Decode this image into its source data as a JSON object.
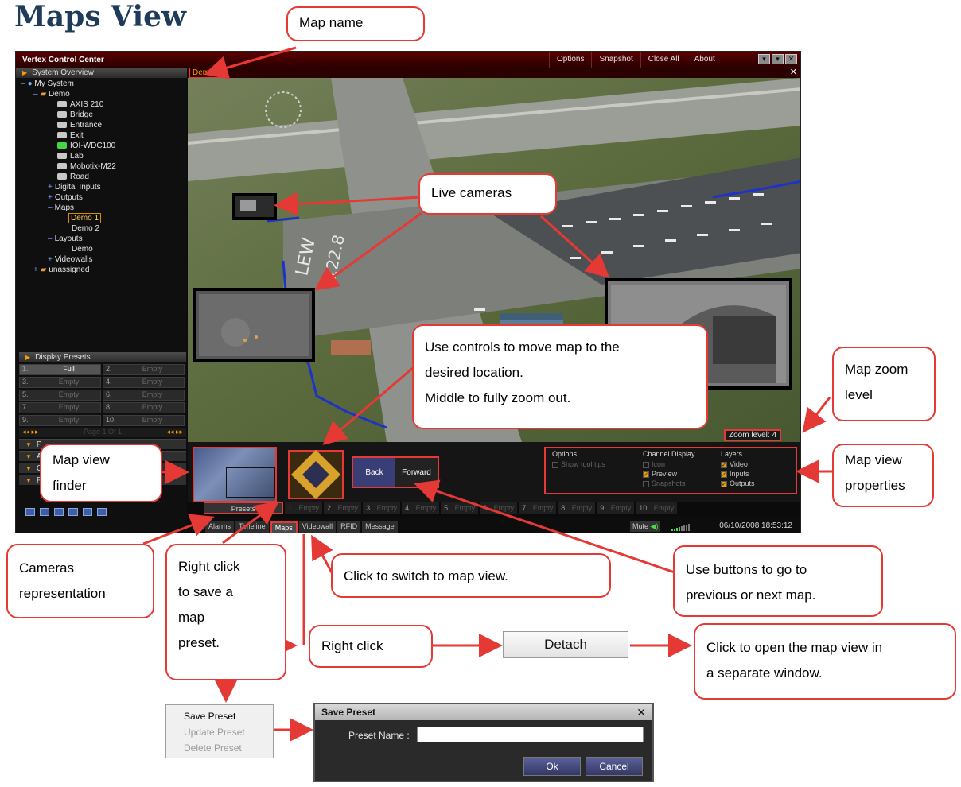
{
  "page": {
    "heading": "Maps View"
  },
  "app": {
    "title": "Vertex Control Center",
    "menu": [
      "Options",
      "Snapshot",
      "Close All",
      "About"
    ],
    "sidebar": {
      "overview_header": "System Overview",
      "tree": [
        {
          "label": "My System",
          "icon": "globe-icon"
        },
        {
          "label": "Demo",
          "icon": "folder-icon"
        },
        {
          "label": "AXIS 210",
          "icon": "camera-icon"
        },
        {
          "label": "Bridge",
          "icon": "camera-icon"
        },
        {
          "label": "Entrance",
          "icon": "camera-icon"
        },
        {
          "label": "Exit",
          "icon": "camera-icon"
        },
        {
          "label": "IOI-WDC100",
          "icon": "camera-icon"
        },
        {
          "label": "Lab",
          "icon": "camera-icon"
        },
        {
          "label": "Mobotix-M22",
          "icon": "camera-icon"
        },
        {
          "label": "Road",
          "icon": "camera-icon"
        },
        {
          "label": "Digital Inputs",
          "icon": "plus-icon"
        },
        {
          "label": "Outputs",
          "icon": "plus-icon"
        },
        {
          "label": "Maps",
          "icon": "minus-icon"
        },
        {
          "label": "Demo 1",
          "icon": "map-icon"
        },
        {
          "label": "Demo 2",
          "icon": "map-icon"
        },
        {
          "label": "Layouts",
          "icon": "minus-icon"
        },
        {
          "label": "Demo",
          "icon": "layout-icon"
        },
        {
          "label": "Videowalls",
          "icon": "plus-icon"
        },
        {
          "label": "unassigned",
          "icon": "folder-icon"
        }
      ],
      "display_presets_header": "Display Presets",
      "display_presets": [
        {
          "num": "1.",
          "label": "Full"
        },
        {
          "num": "2.",
          "label": "Empty"
        },
        {
          "num": "3.",
          "label": "Empty"
        },
        {
          "num": "4.",
          "label": "Empty"
        },
        {
          "num": "5.",
          "label": "Empty"
        },
        {
          "num": "6.",
          "label": "Empty"
        },
        {
          "num": "7.",
          "label": "Empty"
        },
        {
          "num": "8.",
          "label": "Empty"
        },
        {
          "num": "9.",
          "label": "Empty"
        },
        {
          "num": "10.",
          "label": "Empty"
        }
      ],
      "preset_page": "Page 1 Of 1",
      "collapsed_sections": [
        "P",
        "A",
        "C",
        "P"
      ]
    },
    "map_name": "Demo 1",
    "zoom_level": "Zoom level: 4",
    "nav": {
      "back": "Back",
      "forward": "Forward"
    },
    "properties": {
      "options_title": "Options",
      "options": [
        {
          "label": "Show tool tips",
          "checked": false
        }
      ],
      "channel_title": "Channel Display",
      "channel": [
        {
          "label": "Icon",
          "checked": false
        },
        {
          "label": "Preview",
          "checked": true
        },
        {
          "label": "Snapshots",
          "checked": false
        }
      ],
      "layers_title": "Layers",
      "layers": [
        {
          "label": "Video",
          "checked": true
        },
        {
          "label": "Inputs",
          "checked": true
        },
        {
          "label": "Outputs",
          "checked": true
        }
      ]
    },
    "preset_tabs": {
      "main": "Presets",
      "items": [
        {
          "num": "1.",
          "label": "Empty"
        },
        {
          "num": "2.",
          "label": "Empty"
        },
        {
          "num": "3.",
          "label": "Empty"
        },
        {
          "num": "4.",
          "label": "Empty"
        },
        {
          "num": "5.",
          "label": "Empty"
        },
        {
          "num": "6.",
          "label": "Empty"
        },
        {
          "num": "7.",
          "label": "Empty"
        },
        {
          "num": "8.",
          "label": "Empty"
        },
        {
          "num": "9.",
          "label": "Empty"
        },
        {
          "num": "10.",
          "label": "Empty"
        }
      ]
    },
    "bottom_tabs": [
      "Alarms",
      "Timeline",
      "Maps",
      "Videowall",
      "RFID",
      "Message"
    ],
    "mute_label": "Mute",
    "datetime": "06/10/2008 18:53:12"
  },
  "callouts": {
    "map_name": "Map name",
    "live_cameras": "Live cameras",
    "controls_line1": "Use controls to move map to the",
    "controls_line2": "desired location.",
    "controls_line3": "Middle to fully zoom out.",
    "zoom_line1": "Map zoom",
    "zoom_line2": "level",
    "viewfinder_line1": "Map view",
    "viewfinder_line2": "finder",
    "properties_line1": "Map view",
    "properties_line2": "properties",
    "cameras_line1": "Cameras",
    "cameras_line2": "representation",
    "right_click_save_line1": "Right click",
    "right_click_save_line2": "to save a",
    "right_click_save_line3": "map",
    "right_click_save_line4": "preset.",
    "switch_map": "Click to switch to map view.",
    "buttons_line1": "Use buttons to go to",
    "buttons_line2": "previous or next map.",
    "right_click": "Right click",
    "open_window_line1": "Click to open the map view in",
    "open_window_line2": "a separate window."
  },
  "detach_button": "Detach",
  "context_menu": [
    "Save Preset",
    "Update Preset",
    "Delete Preset"
  ],
  "save_dialog": {
    "title": "Save Preset",
    "label": "Preset Name :",
    "ok": "Ok",
    "cancel": "Cancel"
  },
  "colors": {
    "annotation": "#e53935",
    "accent": "#ff9a00",
    "titlebar": "#4a0000"
  }
}
